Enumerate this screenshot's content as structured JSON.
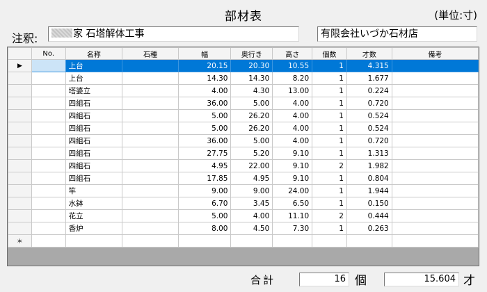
{
  "header": {
    "title": "部材表",
    "unit": "(単位:寸)"
  },
  "note": {
    "label": "注釈:",
    "value": "家 石塔解体工事",
    "company": "有限会社いづか石材店"
  },
  "grid": {
    "columns": [
      "No.",
      "名称",
      "石種",
      "幅",
      "奥行き",
      "高さ",
      "個数",
      "才数",
      "備考"
    ],
    "current_row_marker": "▶",
    "new_row_marker": "＊",
    "rows": [
      {
        "no": "",
        "name": "上台",
        "stone": "",
        "width": "20.15",
        "depth": "20.30",
        "height": "10.55",
        "count": "1",
        "volume": "4.315",
        "remarks": ""
      },
      {
        "no": "",
        "name": "上台",
        "stone": "",
        "width": "14.30",
        "depth": "14.30",
        "height": "8.20",
        "count": "1",
        "volume": "1.677",
        "remarks": ""
      },
      {
        "no": "",
        "name": "塔婆立",
        "stone": "",
        "width": "4.00",
        "depth": "4.30",
        "height": "13.00",
        "count": "1",
        "volume": "0.224",
        "remarks": ""
      },
      {
        "no": "",
        "name": "四組石",
        "stone": "",
        "width": "36.00",
        "depth": "5.00",
        "height": "4.00",
        "count": "1",
        "volume": "0.720",
        "remarks": ""
      },
      {
        "no": "",
        "name": "四組石",
        "stone": "",
        "width": "5.00",
        "depth": "26.20",
        "height": "4.00",
        "count": "1",
        "volume": "0.524",
        "remarks": ""
      },
      {
        "no": "",
        "name": "四組石",
        "stone": "",
        "width": "5.00",
        "depth": "26.20",
        "height": "4.00",
        "count": "1",
        "volume": "0.524",
        "remarks": ""
      },
      {
        "no": "",
        "name": "四組石",
        "stone": "",
        "width": "36.00",
        "depth": "5.00",
        "height": "4.00",
        "count": "1",
        "volume": "0.720",
        "remarks": ""
      },
      {
        "no": "",
        "name": "四組石",
        "stone": "",
        "width": "27.75",
        "depth": "5.20",
        "height": "9.10",
        "count": "1",
        "volume": "1.313",
        "remarks": ""
      },
      {
        "no": "",
        "name": "四組石",
        "stone": "",
        "width": "4.95",
        "depth": "22.00",
        "height": "9.10",
        "count": "2",
        "volume": "1.982",
        "remarks": ""
      },
      {
        "no": "",
        "name": "四組石",
        "stone": "",
        "width": "17.85",
        "depth": "4.95",
        "height": "9.10",
        "count": "1",
        "volume": "0.804",
        "remarks": ""
      },
      {
        "no": "",
        "name": "竿",
        "stone": "",
        "width": "9.00",
        "depth": "9.00",
        "height": "24.00",
        "count": "1",
        "volume": "1.944",
        "remarks": ""
      },
      {
        "no": "",
        "name": "水鉢",
        "stone": "",
        "width": "6.70",
        "depth": "3.45",
        "height": "6.50",
        "count": "1",
        "volume": "0.150",
        "remarks": ""
      },
      {
        "no": "",
        "name": "花立",
        "stone": "",
        "width": "5.00",
        "depth": "4.00",
        "height": "11.10",
        "count": "2",
        "volume": "0.444",
        "remarks": ""
      },
      {
        "no": "",
        "name": "香炉",
        "stone": "",
        "width": "8.00",
        "depth": "4.50",
        "height": "7.30",
        "count": "1",
        "volume": "0.263",
        "remarks": ""
      }
    ]
  },
  "totals": {
    "label": "合計",
    "count": "16",
    "count_unit": "個",
    "volume": "15.604",
    "volume_unit": "才"
  },
  "colors": {
    "selection": "#0078d7"
  }
}
